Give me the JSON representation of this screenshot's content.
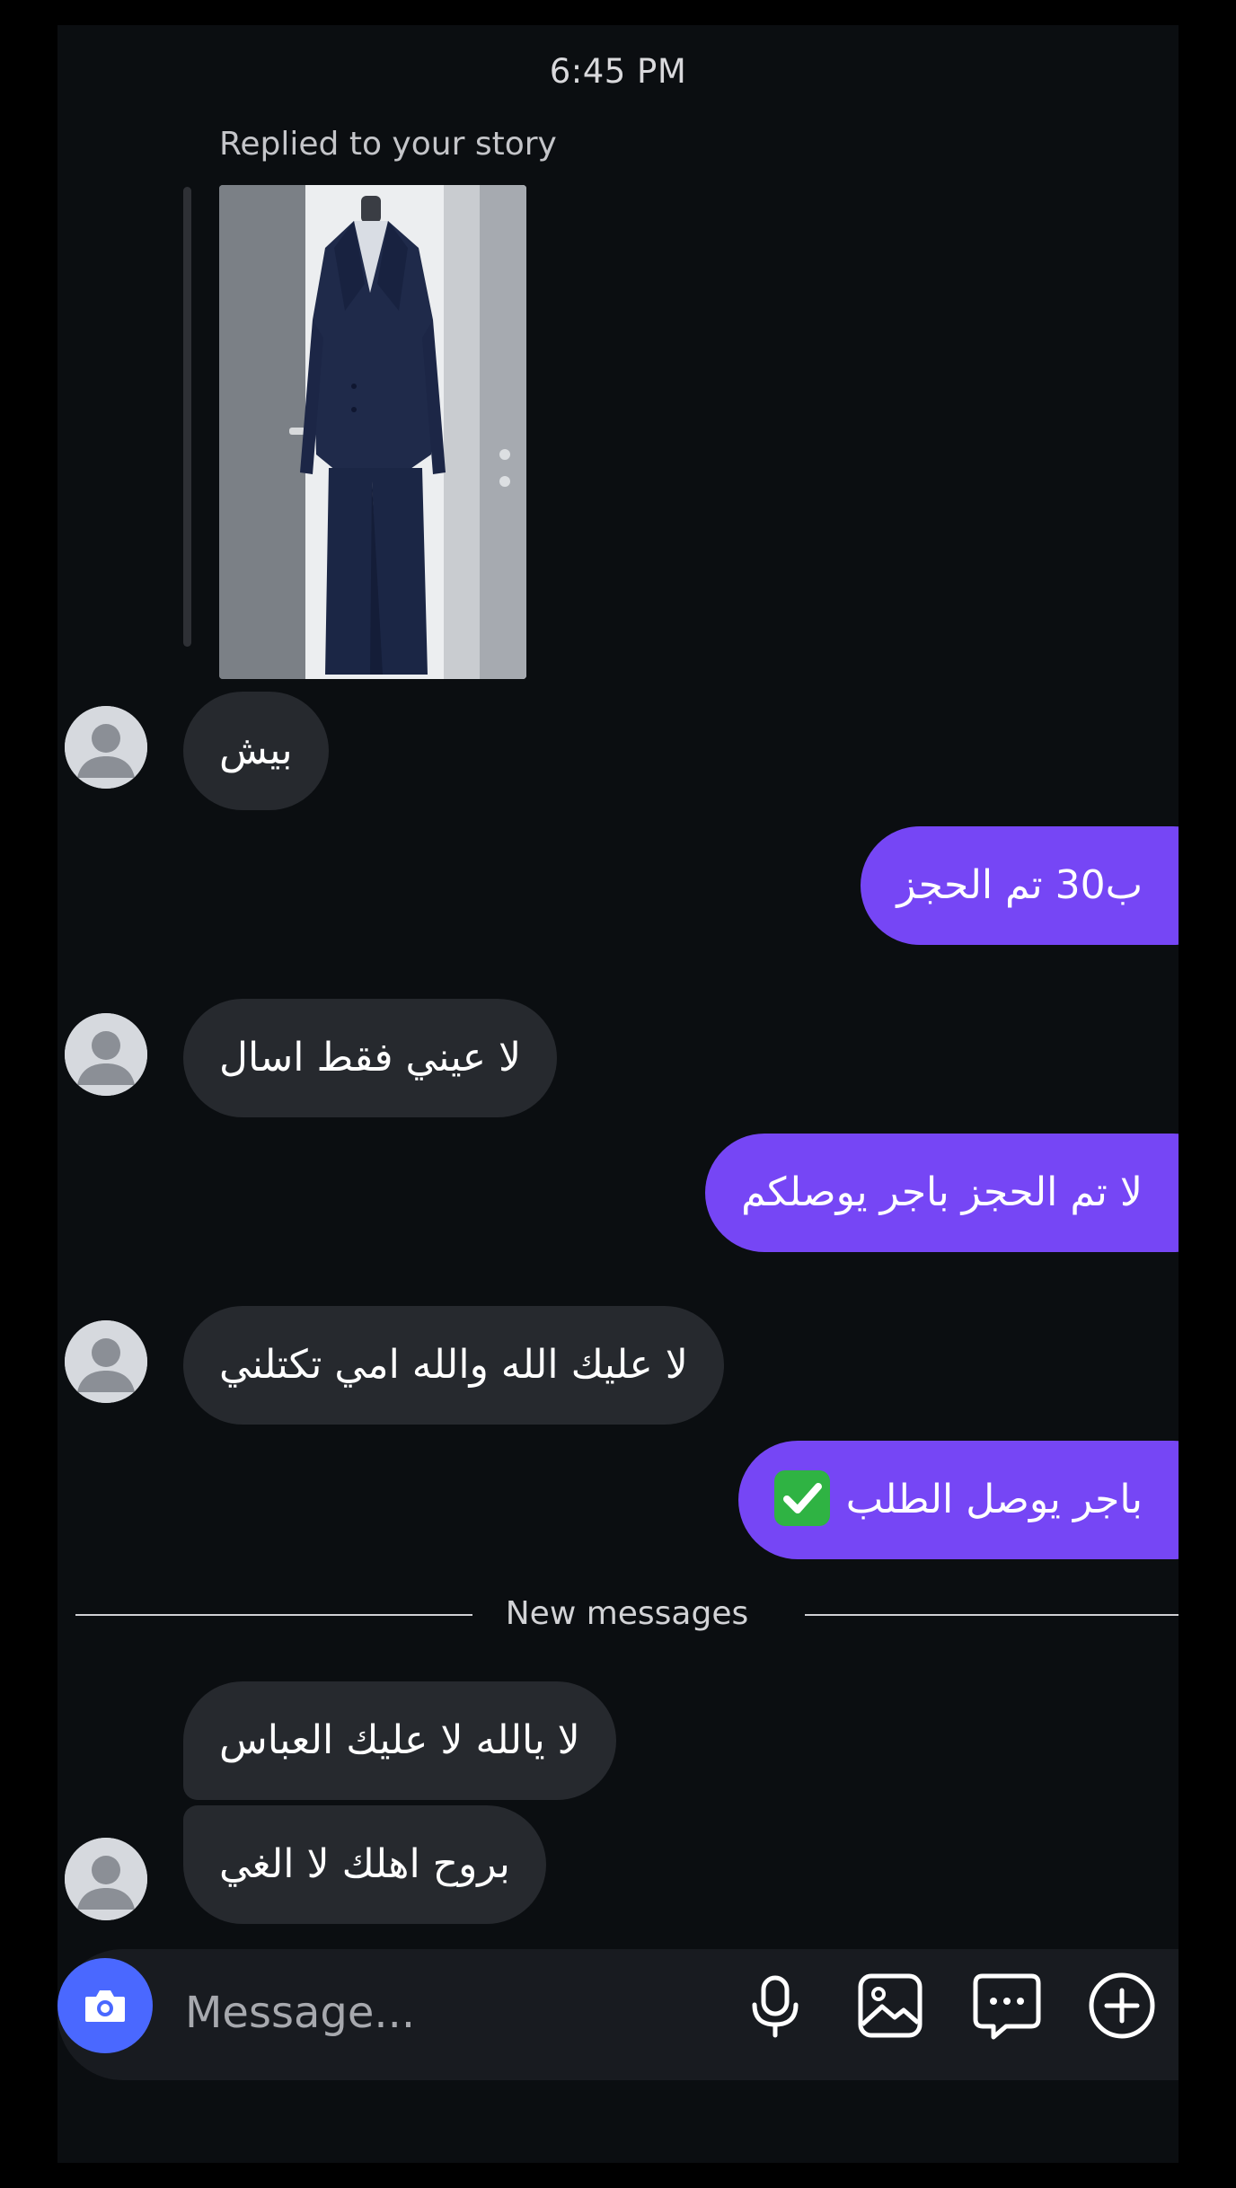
{
  "header": {
    "timestamp": "6:45 PM"
  },
  "story_reply": {
    "label": "Replied to your story",
    "image_icon": "navy-suit-photo"
  },
  "messages": [
    {
      "side": "incoming",
      "text": "بيش"
    },
    {
      "side": "outgoing",
      "text": "ب30 تم الحجز"
    },
    {
      "side": "incoming",
      "text": "لا عيني فقط اسال"
    },
    {
      "side": "outgoing",
      "text": "لا تم الحجز باجر يوصلكم"
    },
    {
      "side": "incoming",
      "text": "لا عليك الله والله امي تكتلني"
    },
    {
      "side": "outgoing",
      "text": "باجر يوصل الطلب",
      "emoji": "check-mark-button-emoji"
    },
    {
      "side": "incoming",
      "text": "لا يالله لا عليك العباس"
    },
    {
      "side": "incoming",
      "text": "بروح اهلك لا الغي"
    }
  ],
  "divider": {
    "label": "New messages"
  },
  "composer": {
    "placeholder": "Message...",
    "icons": [
      "camera-icon",
      "microphone-icon",
      "gallery-icon",
      "sticker-icon",
      "plus-icon"
    ]
  },
  "colors": {
    "background": "#0b0e11",
    "incoming_bubble": "#26292e",
    "outgoing_bubble": "#7646f5",
    "camera_button": "#4a68ff"
  }
}
